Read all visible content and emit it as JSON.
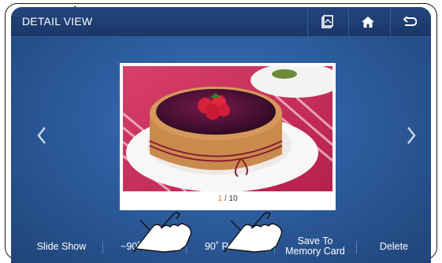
{
  "header": {
    "title": "DETAIL VIEW",
    "buttons": [
      {
        "name": "gallery-icon"
      },
      {
        "name": "home-icon"
      },
      {
        "name": "back-icon"
      }
    ]
  },
  "viewer": {
    "current_index": "1",
    "total": " / 10"
  },
  "toolbar": {
    "slideshow_label": "Slide Show",
    "rotate_left_label": "−90˚ Rotate",
    "rotate_right_label": "90˚ Rotate",
    "save_label": "Save To\nMemory Card",
    "delete_label": "Delete"
  },
  "colors": {
    "screen_bg": "#2d5d9f",
    "header_bg": "#1b3768",
    "counter_accent": "#e9772a"
  }
}
